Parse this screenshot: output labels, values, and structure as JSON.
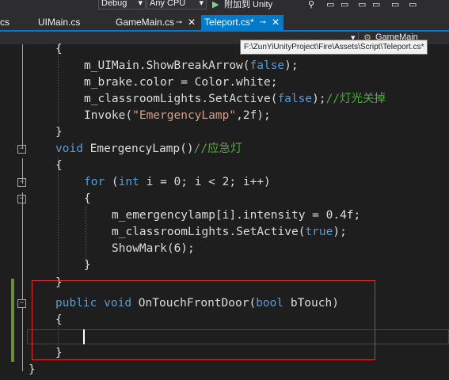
{
  "toolbar": {
    "config": "Debug",
    "platform": "Any CPU",
    "attach": "附加到 Unity"
  },
  "tabs": [
    {
      "label": "cs"
    },
    {
      "label": "UIMain.cs"
    },
    {
      "label": "GameMain.cs"
    },
    {
      "label": "Teleport.cs*"
    }
  ],
  "navbar": {
    "member": "GameMain"
  },
  "tooltip": "F:\\ZunYiUnityProject\\Fire\\Assets\\Script\\Teleport.cs*",
  "code": {
    "l1": "{",
    "l2": {
      "a": "m_UIMain.ShowBreakArrow(",
      "b": "false",
      "c": ");"
    },
    "l3": "m_brake.color = Color.white;",
    "l4": {
      "a": "m_classroomLights.SetActive(",
      "b": "false",
      "c": ");",
      "d": "//灯光关掉"
    },
    "l5": {
      "a": "Invoke(",
      "b": "\"EmergencyLamp\"",
      "c": ",2f);"
    },
    "l6": "}",
    "l7": {
      "a": "void",
      "b": " EmergencyLamp()",
      "c": "//应急灯"
    },
    "l8": "{",
    "l9": {
      "a": "for",
      "b": " (",
      "c": "int",
      "d": " i = 0; i < 2; i++)"
    },
    "l10": "{",
    "l11": "m_emergencylamp[i].intensity = 0.4f;",
    "l12": {
      "a": "m_classroomLights.SetActive(",
      "b": "true",
      "c": ");"
    },
    "l13": "ShowMark(6);",
    "l14": "}",
    "l15": "}",
    "l16": {
      "a": "public",
      "b": " ",
      "c": "void",
      "d": " OnTouchFrontDoor(",
      "e": "bool",
      "f": " bTouch)"
    },
    "l17": "{",
    "l19": "}",
    "l20": "}"
  },
  "colors": {
    "background": "#1e1e1e",
    "keyword": "#569cd6",
    "string": "#d69d85",
    "comment": "#57a64a",
    "accent": "#007acc",
    "highlight_box": "#e03030"
  }
}
